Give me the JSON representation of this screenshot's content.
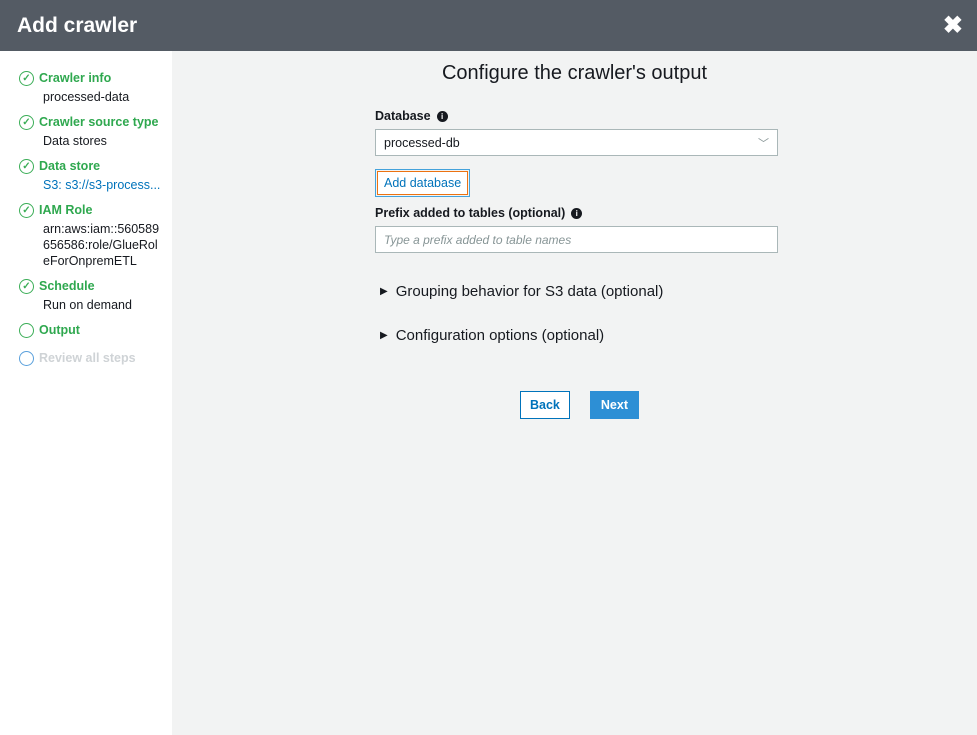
{
  "header": {
    "title": "Add crawler"
  },
  "steps": [
    {
      "label": "Crawler info",
      "detail": "processed-data"
    },
    {
      "label": "Crawler source type",
      "detail": "Data stores"
    },
    {
      "label": "Data store",
      "detail": "S3: s3://s3-process..."
    },
    {
      "label": "IAM Role",
      "detail": "arn:aws:iam::560589656586:role/GlueRoleForOnpremETL"
    },
    {
      "label": "Schedule",
      "detail": "Run on demand"
    },
    {
      "label": "Output"
    },
    {
      "label": "Review all steps"
    }
  ],
  "main": {
    "title": "Configure the crawler's output",
    "database_label": "Database",
    "database_value": "processed-db",
    "add_database": "Add database",
    "prefix_label": "Prefix added to tables (optional)",
    "prefix_placeholder": "Type a prefix added to table names",
    "grouping": "Grouping behavior for S3 data (optional)",
    "config": "Configuration options (optional)",
    "back": "Back",
    "next": "Next"
  }
}
